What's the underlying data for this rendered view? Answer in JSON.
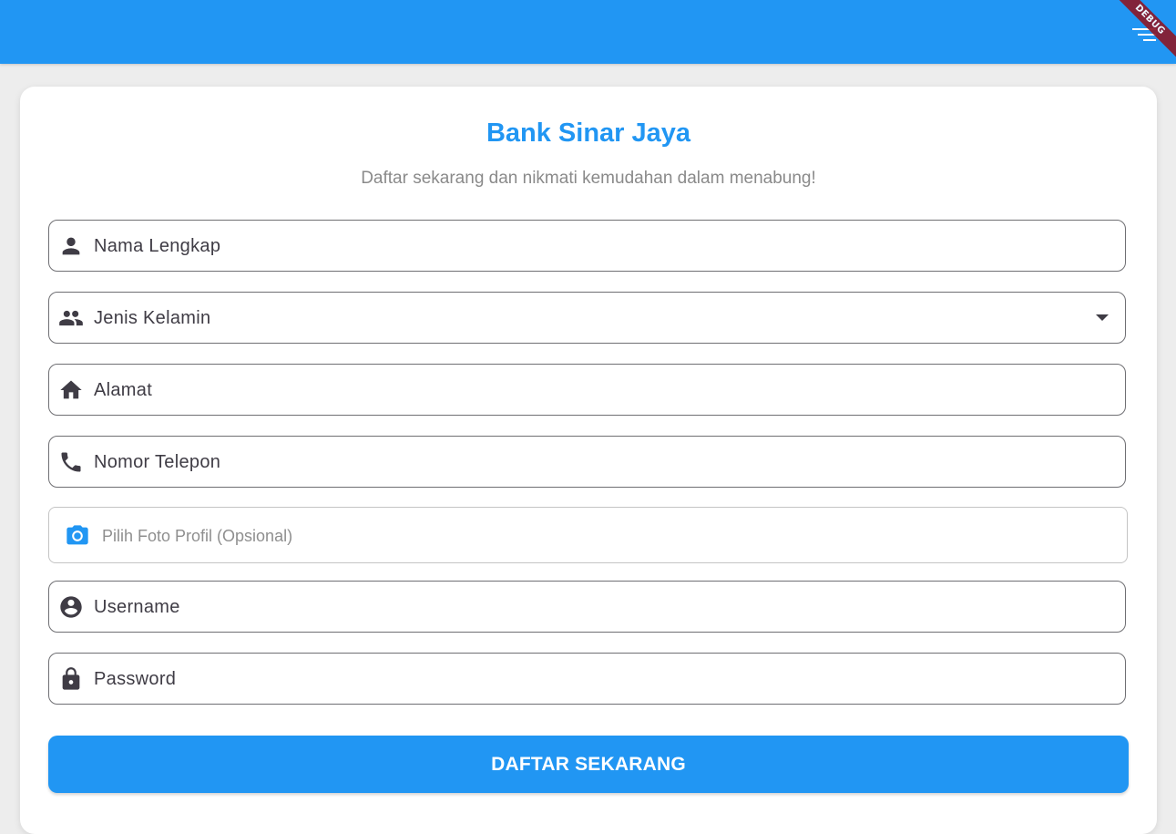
{
  "app_bar": {
    "color": "#2196f3",
    "debug_banner": "DEBUG",
    "menu_icon": "menu-icon"
  },
  "form": {
    "title": "Bank Sinar Jaya",
    "subtitle": "Daftar sekarang dan nikmati kemudahan dalam menabung!",
    "fields": [
      {
        "icon": "person-icon",
        "label": "Nama Lengkap"
      },
      {
        "icon": "people-icon",
        "label": "Jenis Kelamin",
        "type": "dropdown"
      },
      {
        "icon": "home-icon",
        "label": "Alamat"
      },
      {
        "icon": "phone-icon",
        "label": "Nomor Telepon"
      },
      {
        "icon": "camera-icon",
        "label": "Pilih Foto Profil (Opsional)",
        "type": "file-picker"
      },
      {
        "icon": "account-circle-icon",
        "label": "Username"
      },
      {
        "icon": "lock-icon",
        "label": "Password"
      }
    ],
    "submit_label": "DAFTAR SEKARANG"
  },
  "colors": {
    "accent": "#2196f3",
    "background": "#ededed",
    "card": "#ffffff",
    "debug_banner": "#8b1a2b"
  }
}
